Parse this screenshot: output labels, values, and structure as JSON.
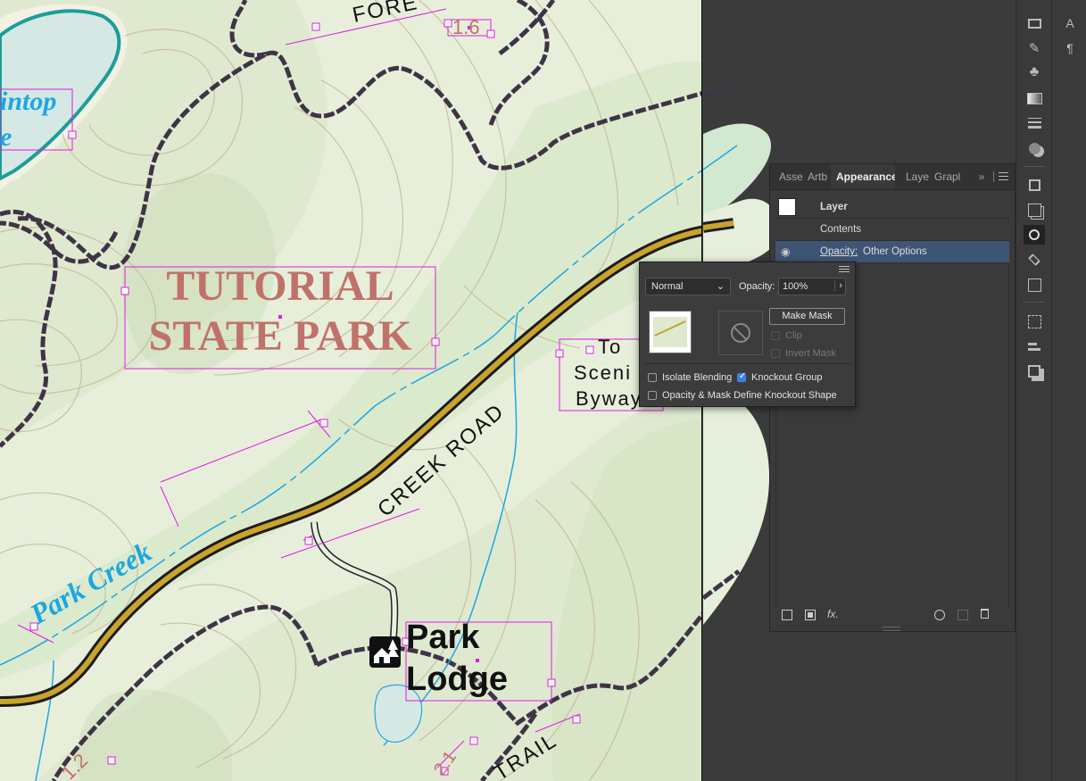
{
  "map": {
    "park_title_line1": "TUTORIAL",
    "park_title_line2": "STATE PARK",
    "road_label": "CREEK ROAD",
    "creek_label": "Park Creek",
    "lodge_line1": "Park",
    "lodge_line2": "Lodge",
    "scenic_line1": "To",
    "scenic_line2": "Sceni",
    "scenic_line3": "Byway",
    "lake_label_1": "intop",
    "lake_label_2": "e",
    "top_road_label": "FORE",
    "trail_label": "TRAIL",
    "mile_1": "1.6",
    "mile_2": "2.1",
    "mile_3": "1.2",
    "colors": {
      "background": "#dfe9d0",
      "contour": "#c9b79a",
      "trail": "#3f3446",
      "road_fill": "#c8a429",
      "water": "#1ca7e3",
      "park_title": "#c0726a",
      "selection": "#e31ae3"
    }
  },
  "panel": {
    "tabs": [
      "Asse",
      "Artb",
      "Appearance",
      "Laye",
      "Grapl"
    ],
    "active_tab": "Appearance",
    "more_icon": "»",
    "rows": {
      "layer": "Layer",
      "contents": "Contents",
      "opacity_label": "Opacity:",
      "opacity_value": "Other Options"
    },
    "bottom_icons": [
      "new-art-icon",
      "duplicate-icon",
      "fx-icon",
      "clear-icon",
      "add-icon",
      "trash-icon"
    ],
    "fx_label": "fx."
  },
  "transparency": {
    "blend_mode": "Normal",
    "opacity_label": "Opacity:",
    "opacity_value": "100%",
    "make_mask": "Make Mask",
    "clip": "Clip",
    "invert_mask": "Invert Mask",
    "isolate_blending": "Isolate Blending",
    "knockout_group": "Knockout Group",
    "opacity_mask_shape": "Opacity & Mask Define Knockout Shape",
    "knockout_checked": true,
    "isolate_checked": false,
    "define_checked": false
  }
}
